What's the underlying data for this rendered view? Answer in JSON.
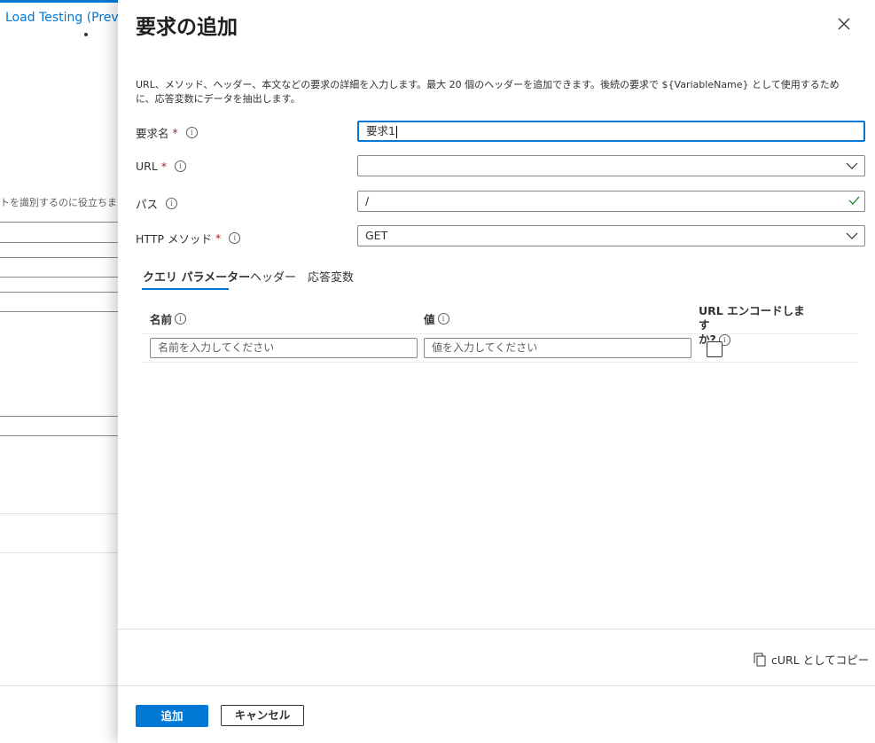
{
  "background": {
    "title": "Load Testing (Prev",
    "hint": "トを識別するのに役立ちま"
  },
  "panel": {
    "title": "要求の追加",
    "description": "URL、メソッド、ヘッダー、本文などの要求の詳細を入力します。最大 20 個のヘッダーを追加できます。後続の要求で ${VariableName} として使用するために、応答変数にデータを抽出します。",
    "close_icon": "close-icon"
  },
  "form": {
    "request_name": {
      "label": "要求名",
      "required": "*",
      "value": "要求1"
    },
    "url": {
      "label": "URL",
      "required": "*",
      "value": ""
    },
    "path": {
      "label": "パス",
      "value": "/"
    },
    "method": {
      "label": "HTTP メソッド",
      "required": "*",
      "value": "GET"
    }
  },
  "tabs": [
    {
      "label": "クエリ パラメーター",
      "active": true
    },
    {
      "label": "ヘッダー",
      "active": false
    },
    {
      "label": "応答変数",
      "active": false
    }
  ],
  "table": {
    "col_name": "名前",
    "col_value": "値",
    "col_encode_line1": "URL エンコードします",
    "col_encode_line2": "か?",
    "name_placeholder": "名前を入力してください",
    "value_placeholder": "値を入力してください"
  },
  "footer": {
    "copy_curl": "cURL としてコピー",
    "add_button": "追加",
    "cancel_button": "キャンセル"
  },
  "colors": {
    "accent": "#0078d4",
    "required": "#a4262c",
    "valid_check": "#107c10"
  }
}
